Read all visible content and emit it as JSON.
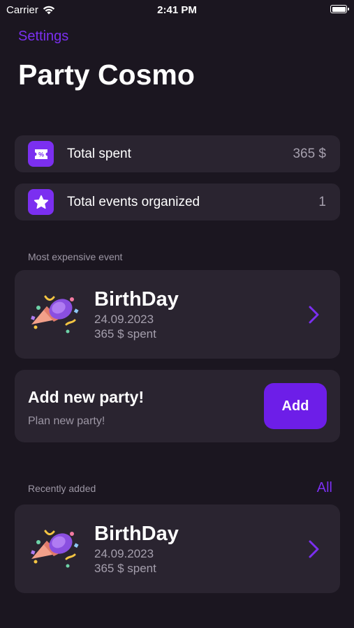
{
  "status_bar": {
    "carrier": "Carrier",
    "time": "2:41 PM"
  },
  "header": {
    "settings_label": "Settings",
    "title": "Party Cosmo"
  },
  "stats": [
    {
      "label": "Total spent",
      "value": "365 $",
      "icon": "ticket-icon"
    },
    {
      "label": "Total events organized",
      "value": "1",
      "icon": "star-icon"
    }
  ],
  "most_expensive": {
    "section_label": "Most expensive event",
    "event": {
      "name": "BirthDay",
      "date": "24.09.2023",
      "spent": "365 $ spent",
      "icon": "party-popper-icon"
    }
  },
  "add_party": {
    "title": "Add new party!",
    "subtitle": "Plan new party!",
    "button_label": "Add"
  },
  "recent": {
    "section_label": "Recently added",
    "all_label": "All",
    "event": {
      "name": "BirthDay",
      "date": "24.09.2023",
      "spent": "365 $ spent",
      "icon": "party-popper-icon"
    }
  },
  "colors": {
    "accent": "#7b2ff0",
    "background": "#1b1620",
    "card": "#2a2430"
  }
}
